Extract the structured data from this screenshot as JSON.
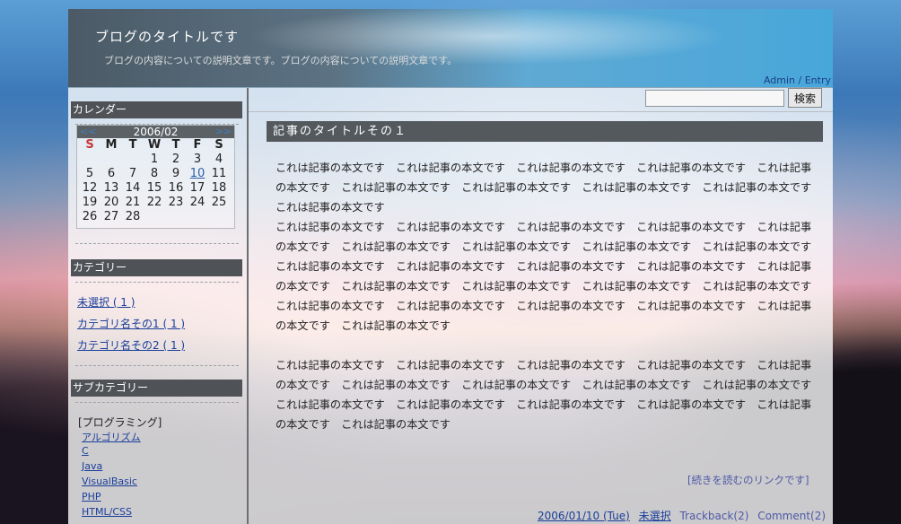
{
  "header": {
    "title": "ブログのタイトルです",
    "description": "ブログの内容についての説明文章です。ブログの内容についての説明文章です。",
    "admin": "Admin",
    "separator": "/",
    "entry": "Entry"
  },
  "search": {
    "value": "",
    "button": "検索"
  },
  "sidebar": {
    "calendar_head": "カレンダー",
    "calendar": {
      "prev": "<<",
      "next": ">>",
      "month": "2006/02",
      "days_of_week": [
        "S",
        "M",
        "T",
        "W",
        "T",
        "F",
        "S"
      ],
      "weeks": [
        [
          "",
          "",
          "",
          "1",
          "2",
          "3",
          "4"
        ],
        [
          "5",
          "6",
          "7",
          "8",
          "9",
          "10",
          "11"
        ],
        [
          "12",
          "13",
          "14",
          "15",
          "16",
          "17",
          "18"
        ],
        [
          "19",
          "20",
          "21",
          "22",
          "23",
          "24",
          "25"
        ],
        [
          "26",
          "27",
          "28",
          "",
          "",
          "",
          ""
        ]
      ],
      "linked_day": "10"
    },
    "category_head": "カテゴリー",
    "categories": [
      "未選択 ( 1 )",
      "カテゴリ名その1 ( 1 )",
      "カテゴリ名その2 ( 1 )"
    ],
    "subcategory_head": "サブカテゴリー",
    "subcategory_group": "[プログラミング]",
    "subcategories": [
      "アルゴリズム",
      "C",
      "Java",
      "VisualBasic",
      "PHP",
      "HTML/CSS"
    ]
  },
  "entry": {
    "title": "記事のタイトルその１",
    "paragraph_1": "これは記事の本文です　これは記事の本文です　これは記事の本文です　これは記事の本文です　これは記事の本文です　これは記事の本文です　これは記事の本文です　これは記事の本文です　これは記事の本文です　これは記事の本文です",
    "paragraph_2": "これは記事の本文です　これは記事の本文です　これは記事の本文です　これは記事の本文です　これは記事の本文です　これは記事の本文です　これは記事の本文です　これは記事の本文です　これは記事の本文です",
    "paragraph_3": "これは記事の本文です　これは記事の本文です　これは記事の本文です　これは記事の本文です　これは記事の本文です　これは記事の本文です　これは記事の本文です　これは記事の本文です　これは記事の本文です　これは記事の本文です　これは記事の本文です　これは記事の本文です　これは記事の本文です　これは記事の本文です　これは記事の本文です",
    "paragraph_4": "これは記事の本文です　これは記事の本文です　これは記事の本文です　これは記事の本文です　これは記事の本文です　これは記事の本文です　これは記事の本文です　これは記事の本文です　これは記事の本文です　これは記事の本文です　これは記事の本文です　これは記事の本文です　これは記事の本文です　これは記事の本文です　これは記事の本文です",
    "read_more": "[続きを読むのリンクです]",
    "date": "2006/01/10 (Tue)",
    "category": "未選択",
    "trackback": "Trackback(2)",
    "comment": "Comment(2)"
  }
}
